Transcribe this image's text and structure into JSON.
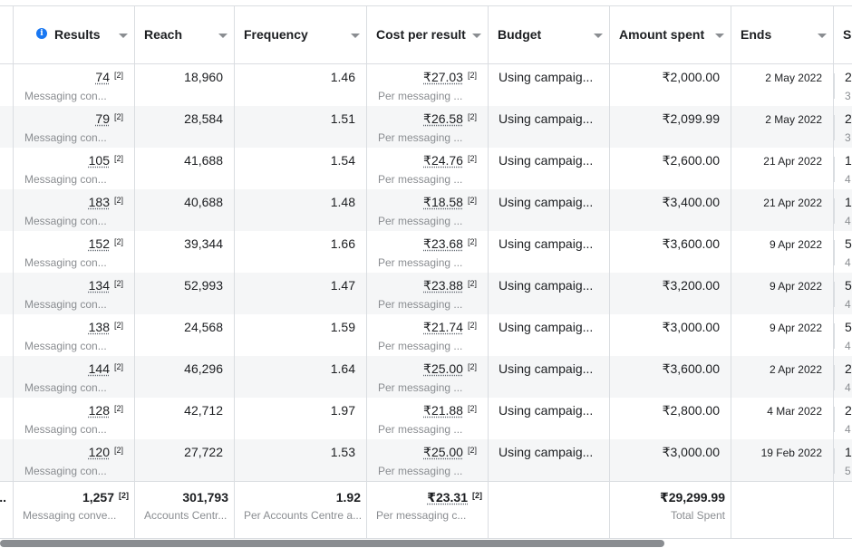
{
  "columns": {
    "results": "Results",
    "reach": "Reach",
    "frequency": "Frequency",
    "cost_per_result": "Cost per result",
    "budget": "Budget",
    "amount_spent": "Amount spent",
    "ends": "Ends",
    "schedule_partial": "Sc"
  },
  "ref_marker": "[2]",
  "rows": [
    {
      "results": "74",
      "results_sub": "Messaging con...",
      "reach": "18,960",
      "frequency": "1.46",
      "cpr": "₹27.03",
      "cpr_sub": "Per messaging ...",
      "budget": "Using campaig...",
      "spent": "₹2,000.00",
      "ends": "2 May 2022",
      "sched": "2",
      "sched_sub": "3"
    },
    {
      "results": "79",
      "results_sub": "Messaging con...",
      "reach": "28,584",
      "frequency": "1.51",
      "cpr": "₹26.58",
      "cpr_sub": "Per messaging ...",
      "budget": "Using campaig...",
      "spent": "₹2,099.99",
      "ends": "2 May 2022",
      "sched": "2",
      "sched_sub": "3"
    },
    {
      "results": "105",
      "results_sub": "Messaging con...",
      "reach": "41,688",
      "frequency": "1.54",
      "cpr": "₹24.76",
      "cpr_sub": "Per messaging ...",
      "budget": "Using campaig...",
      "spent": "₹2,600.00",
      "ends": "21 Apr 2022",
      "sched": "1",
      "sched_sub": "4"
    },
    {
      "results": "183",
      "results_sub": "Messaging con...",
      "reach": "40,688",
      "frequency": "1.48",
      "cpr": "₹18.58",
      "cpr_sub": "Per messaging ...",
      "budget": "Using campaig...",
      "spent": "₹3,400.00",
      "ends": "21 Apr 2022",
      "sched": "1",
      "sched_sub": "4"
    },
    {
      "results": "152",
      "results_sub": "Messaging con...",
      "reach": "39,344",
      "frequency": "1.66",
      "cpr": "₹23.68",
      "cpr_sub": "Per messaging ...",
      "budget": "Using campaig...",
      "spent": "₹3,600.00",
      "ends": "9 Apr 2022",
      "sched": "5",
      "sched_sub": "4"
    },
    {
      "results": "134",
      "results_sub": "Messaging con...",
      "reach": "52,993",
      "frequency": "1.47",
      "cpr": "₹23.88",
      "cpr_sub": "Per messaging ...",
      "budget": "Using campaig...",
      "spent": "₹3,200.00",
      "ends": "9 Apr 2022",
      "sched": "5",
      "sched_sub": "4"
    },
    {
      "results": "138",
      "results_sub": "Messaging con...",
      "reach": "24,568",
      "frequency": "1.59",
      "cpr": "₹21.74",
      "cpr_sub": "Per messaging ...",
      "budget": "Using campaig...",
      "spent": "₹3,000.00",
      "ends": "9 Apr 2022",
      "sched": "5",
      "sched_sub": "4"
    },
    {
      "results": "144",
      "results_sub": "Messaging con...",
      "reach": "46,296",
      "frequency": "1.64",
      "cpr": "₹25.00",
      "cpr_sub": "Per messaging ...",
      "budget": "Using campaig...",
      "spent": "₹3,600.00",
      "ends": "2 Apr 2022",
      "sched": "2",
      "sched_sub": "4"
    },
    {
      "results": "128",
      "results_sub": "Messaging con...",
      "reach": "42,712",
      "frequency": "1.97",
      "cpr": "₹21.88",
      "cpr_sub": "Per messaging ...",
      "budget": "Using campaig...",
      "spent": "₹2,800.00",
      "ends": "4 Mar 2022",
      "sched": "2",
      "sched_sub": "4"
    },
    {
      "results": "120",
      "results_sub": "Messaging con...",
      "reach": "27,722",
      "frequency": "1.53",
      "cpr": "₹25.00",
      "cpr_sub": "Per messaging ...",
      "budget": "Using campaig...",
      "spent": "₹3,000.00",
      "ends": "19 Feb 2022",
      "sched": "1",
      "sched_sub": "5"
    }
  ],
  "totals": {
    "lead": "...",
    "results": "1,257",
    "results_sub": "Messaging conve...",
    "reach": "301,793",
    "reach_sub": "Accounts Centr...",
    "frequency": "1.92",
    "frequency_sub": "Per Accounts Centre a...",
    "cpr": "₹23.31",
    "cpr_sub": "Per messaging c...",
    "spent": "₹29,299.99",
    "spent_sub": "Total Spent"
  },
  "colors": {
    "accent": "#1877f2",
    "border": "#dadde1",
    "row_shade": "#f5f6f7",
    "muted_text": "#8a8d91"
  }
}
